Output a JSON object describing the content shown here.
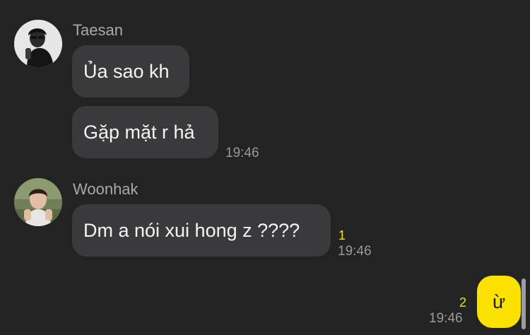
{
  "chat": {
    "messages": [
      {
        "sender": "Taesan",
        "avatar_icon": "avatar-taesan-icon",
        "bubbles": [
          "Ủa sao kh",
          "Gặp mặt r hả"
        ],
        "time": "19:46"
      },
      {
        "sender": "Woonhak",
        "avatar_icon": "avatar-woonhak-icon",
        "bubbles": [
          "Dm a nói xui hong z ????"
        ],
        "unread": "1",
        "time": "19:46"
      },
      {
        "sender": "me",
        "bubbles": [
          "ừ"
        ],
        "unread": "2",
        "time": "19:46"
      }
    ]
  },
  "colors": {
    "background": "#232323",
    "incoming_bubble": "#3a3a3c",
    "outgoing_bubble": "#fae100",
    "unread_count": "#fae100",
    "timestamp": "#9a9a9a",
    "sender_name": "#a9a9a9"
  }
}
